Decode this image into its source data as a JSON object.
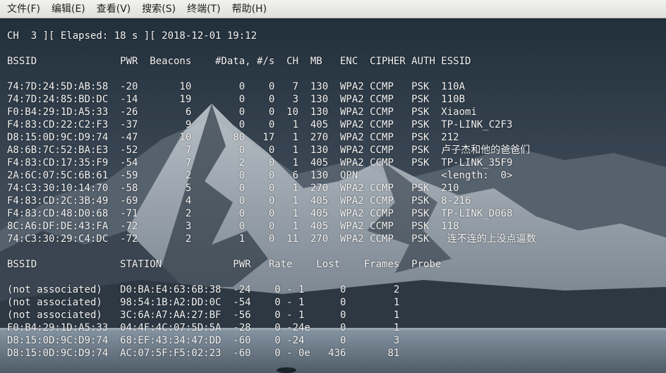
{
  "menubar": {
    "items": [
      {
        "name": "menu-file",
        "label": "文件(F)"
      },
      {
        "name": "menu-edit",
        "label": "编辑(E)"
      },
      {
        "name": "menu-view",
        "label": "查看(V)"
      },
      {
        "name": "menu-search",
        "label": "搜索(S)"
      },
      {
        "name": "menu-terminal",
        "label": "终端(T)"
      },
      {
        "name": "menu-help",
        "label": "帮助(H)"
      }
    ]
  },
  "terminal": {
    "lines": [
      {
        "name": "status-line",
        "text": "CH  3 ][ Elapsed: 18 s ][ 2018-12-01 19:12"
      },
      {
        "name": "blank-line",
        "text": ""
      },
      {
        "name": "ap-header-row",
        "text": "BSSID              PWR  Beacons    #Data, #/s  CH  MB   ENC  CIPHER AUTH ESSID"
      },
      {
        "name": "blank-line",
        "text": ""
      },
      {
        "name": "ap-row",
        "text": "74:7D:24:5D:AB:58  -20       10        0    0   7  130  WPA2 CCMP   PSK  110A"
      },
      {
        "name": "ap-row",
        "text": "74:7D:24:85:BD:DC  -14       19        0    0   3  130  WPA2 CCMP   PSK  110B"
      },
      {
        "name": "ap-row",
        "text": "F0:B4:29:1D:A5:33  -26        6        0    0  10  130  WPA2 CCMP   PSK  Xiaomi"
      },
      {
        "name": "ap-row",
        "text": "F4:83:CD:22:C2:F3  -37        9        0    0   1  405  WPA2 CCMP   PSK  TP-LINK_C2F3"
      },
      {
        "name": "ap-row",
        "text": "D8:15:0D:9C:D9:74  -47       10       80   17   1  270  WPA2 CCMP   PSK  212"
      },
      {
        "name": "ap-row",
        "text": "A8:6B:7C:52:BA:E3  -52        7        0    0   1  130  WPA2 CCMP   PSK  卢子杰和他的爸爸们"
      },
      {
        "name": "ap-row",
        "text": "F4:83:CD:17:35:F9  -54        7        2    0   1  405  WPA2 CCMP   PSK  TP-LINK_35F9"
      },
      {
        "name": "ap-row",
        "text": "2A:6C:07:5C:6B:61  -59        2        0    0   6  130  OPN              <length:  0>"
      },
      {
        "name": "ap-row",
        "text": "74:C3:30:10:14:70  -58        5        0    0   1  270  WPA2 CCMP   PSK  210"
      },
      {
        "name": "ap-row",
        "text": "F4:83:CD:2C:3B:49  -69        4        0    0   1  405  WPA2 CCMP   PSK  8-216"
      },
      {
        "name": "ap-row",
        "text": "F4:83:CD:48:D0:68  -71        2        0    0   1  405  WPA2 CCMP   PSK  TP-LINK_D068"
      },
      {
        "name": "ap-row",
        "text": "8C:A6:DF:DE:43:FA  -72        3        0    0   1  405  WPA2 CCMP   PSK  118"
      },
      {
        "name": "ap-row",
        "text": "74:C3:30:29:C4:DC  -72        2        1    0  11  270  WPA2 CCMP   PSK   连不连的上没点逼数"
      },
      {
        "name": "blank-line",
        "text": ""
      },
      {
        "name": "station-header-row",
        "text": "BSSID              STATION            PWR   Rate    Lost    Frames  Probe"
      },
      {
        "name": "blank-line",
        "text": ""
      },
      {
        "name": "station-row",
        "text": "(not associated)   D0:BA:E4:63:6B:38  -24    0 - 1      0        2"
      },
      {
        "name": "station-row",
        "text": "(not associated)   98:54:1B:A2:DD:0C  -54    0 - 1      0        1"
      },
      {
        "name": "station-row",
        "text": "(not associated)   3C:6A:A7:AA:27:BF  -56    0 - 1      0        1"
      },
      {
        "name": "station-row",
        "text": "F0:B4:29:1D:A5:33  04:4F:4C:07:5D:5A  -28    0 -24e     0        1"
      },
      {
        "name": "station-row",
        "text": "D8:15:0D:9C:D9:74  68:EF:43:34:47:DD  -60    0 -24      0        3"
      },
      {
        "name": "station-row",
        "text": "D8:15:0D:9C:D9:74  AC:07:5F:F5:02:23  -60    0 - 0e   436       81"
      }
    ]
  }
}
